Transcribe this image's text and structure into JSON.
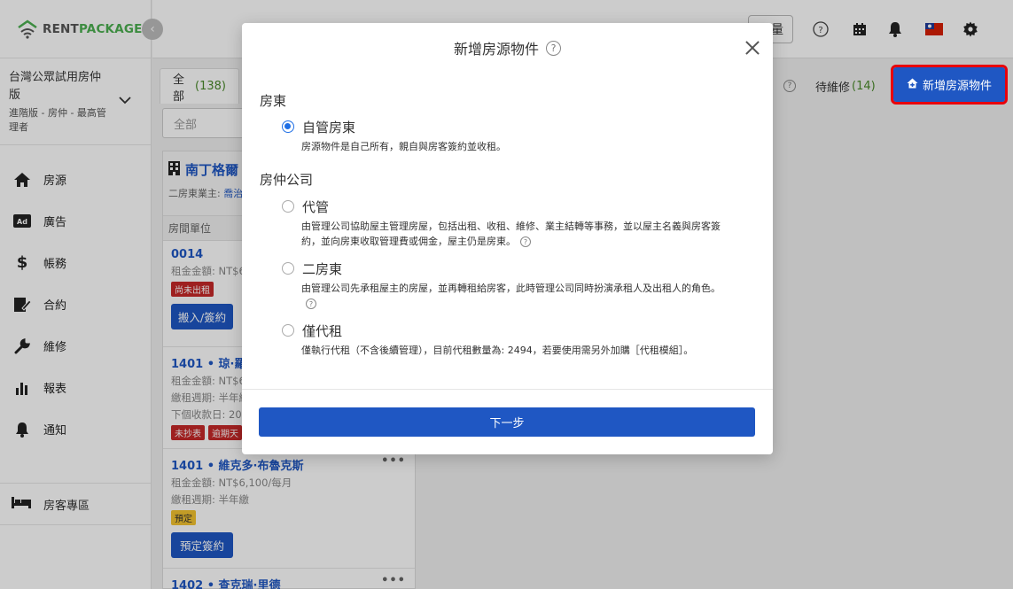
{
  "brand": {
    "name_a": "RENT",
    "name_b": "PACKAGE"
  },
  "account": {
    "name": "台灣公眾試用房仲版",
    "role": "進階版 - 房仲 - 最高管理者"
  },
  "sidebar": {
    "items": [
      {
        "label": "房源",
        "icon": "home-icon"
      },
      {
        "label": "廣告",
        "icon": "ad-icon"
      },
      {
        "label": "帳務",
        "icon": "dollar-icon"
      },
      {
        "label": "合約",
        "icon": "contract-icon"
      },
      {
        "label": "維修",
        "icon": "wrench-icon"
      },
      {
        "label": "報表",
        "icon": "bar-chart-icon"
      },
      {
        "label": "通知",
        "icon": "bell-icon"
      }
    ],
    "tenant_label": "房客專區"
  },
  "topbar": {
    "outline_btn": "量"
  },
  "tabs": {
    "all_label": "全部",
    "all_count": "(138)",
    "repair_label": "待維修",
    "repair_count": "(14)"
  },
  "filter": {
    "value": "全部"
  },
  "add_button": {
    "label": "新增房源物件"
  },
  "property": {
    "title": "南丁格爾",
    "sub_label": "二房東業主:",
    "sub_value": "喬治",
    "col_head": "房間單位"
  },
  "units": [
    {
      "name": "0014",
      "lines": [
        "租金金額: NT$6"
      ],
      "tags": [
        {
          "text": "尚未出租",
          "color": "red"
        }
      ],
      "button": "搬入/簽約"
    },
    {
      "name": "1401 • 琼·羅德",
      "lines": [
        "租金金額: NT$6",
        "繳租週期: 半年繳",
        "下個收款日: 20"
      ],
      "tags": [
        {
          "text": "未抄表",
          "color": "red"
        },
        {
          "text": "逾期天",
          "color": "red"
        }
      ],
      "button": ""
    },
    {
      "name": "1401 • 維克多·布魯克斯",
      "lines": [
        "租金金額: NT$6,100/每月",
        "繳租週期: 半年繳"
      ],
      "tags": [
        {
          "text": "預定",
          "color": "yellow"
        }
      ],
      "button": "預定簽約"
    },
    {
      "name": "1402 • 查克瑞·里德",
      "lines": [],
      "tags": [],
      "button": ""
    }
  ],
  "modal": {
    "title": "新增房源物件",
    "group_landlord": "房東",
    "group_agency": "房仲公司",
    "options": [
      {
        "label": "自管房東",
        "desc": "房源物件是自己所有，親自與房客簽約並收租。",
        "selected": true
      },
      {
        "label": "代管",
        "desc": "由管理公司協助屋主管理房屋，包括出租、收租、維修、業主結轉等事務，並以屋主名義與房客簽約，並向房東收取管理費或佣金，屋主仍是房東。",
        "selected": false
      },
      {
        "label": "二房東",
        "desc": "由管理公司先承租屋主的房屋，並再轉租給房客，此時管理公司同時扮演承租人及出租人的角色。",
        "selected": false
      },
      {
        "label": "僅代租",
        "desc": "僅執行代租（不含後續管理），目前代租數量為: 2494，若要使用需另外加購［代租模組］。",
        "selected": false
      }
    ],
    "next_label": "下一步"
  },
  "colors": {
    "primary": "#1f57c3",
    "highlight": "#e8000b",
    "brand_green": "#4caf50"
  }
}
